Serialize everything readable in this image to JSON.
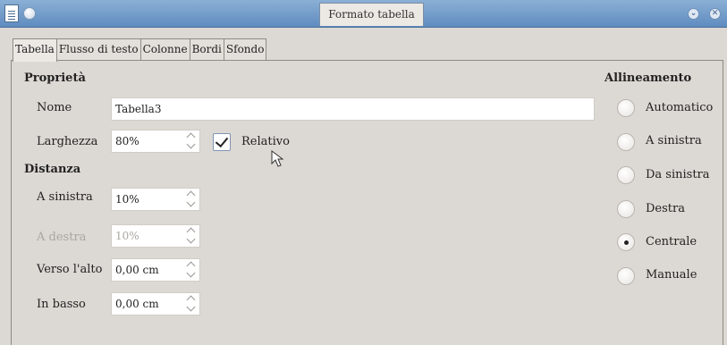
{
  "window": {
    "title": "Formato tabella"
  },
  "tabs": [
    "Tabella",
    "Flusso di testo",
    "Colonne",
    "Bordi",
    "Sfondo"
  ],
  "properties": {
    "section": "Proprietà",
    "name_label": "Nome",
    "name_value": "Tabella3",
    "width_label": "Larghezza",
    "width_value": "80%",
    "relative_label": "Relativo"
  },
  "spacing": {
    "section": "Distanza",
    "left_label": "A sinistra",
    "left_value": "10%",
    "right_label": "A destra",
    "right_value": "10%",
    "top_label": "Verso l'alto",
    "top_value": "0,00 cm",
    "bottom_label": "In basso",
    "bottom_value": "0,00 cm"
  },
  "alignment": {
    "section": "Allineamento",
    "options": [
      "Automatico",
      "A sinistra",
      "Da sinistra",
      "Destra",
      "Centrale",
      "Manuale"
    ],
    "selected": "Centrale"
  }
}
